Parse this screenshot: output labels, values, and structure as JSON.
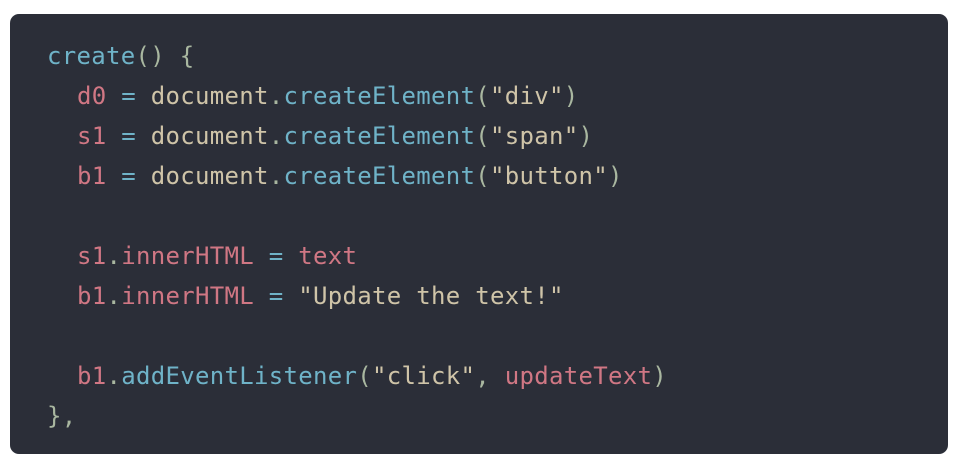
{
  "colors": {
    "background": "#2b2e38",
    "function": "#6fb3c8",
    "variable": "#d07784",
    "plain": "#cfc4a8",
    "punctuation": "#a9b7a0",
    "string": "#cfc4a8"
  },
  "code": {
    "lines": [
      [
        {
          "text": "create",
          "kind": "function"
        },
        {
          "text": "() {",
          "kind": "punctuation"
        }
      ],
      [
        {
          "text": "d0",
          "kind": "variable"
        },
        {
          "text": " = ",
          "kind": "function"
        },
        {
          "text": "document",
          "kind": "plain"
        },
        {
          "text": ".",
          "kind": "punctuation"
        },
        {
          "text": "createElement",
          "kind": "function"
        },
        {
          "text": "(",
          "kind": "punctuation"
        },
        {
          "text": "\"div\"",
          "kind": "string"
        },
        {
          "text": ")",
          "kind": "punctuation"
        }
      ],
      [
        {
          "text": "s1",
          "kind": "variable"
        },
        {
          "text": " = ",
          "kind": "function"
        },
        {
          "text": "document",
          "kind": "plain"
        },
        {
          "text": ".",
          "kind": "punctuation"
        },
        {
          "text": "createElement",
          "kind": "function"
        },
        {
          "text": "(",
          "kind": "punctuation"
        },
        {
          "text": "\"span\"",
          "kind": "string"
        },
        {
          "text": ")",
          "kind": "punctuation"
        }
      ],
      [
        {
          "text": "b1",
          "kind": "variable"
        },
        {
          "text": " = ",
          "kind": "function"
        },
        {
          "text": "document",
          "kind": "plain"
        },
        {
          "text": ".",
          "kind": "punctuation"
        },
        {
          "text": "createElement",
          "kind": "function"
        },
        {
          "text": "(",
          "kind": "punctuation"
        },
        {
          "text": "\"button\"",
          "kind": "string"
        },
        {
          "text": ")",
          "kind": "punctuation"
        }
      ],
      [],
      [
        {
          "text": "s1",
          "kind": "variable"
        },
        {
          "text": ".",
          "kind": "punctuation"
        },
        {
          "text": "innerHTML",
          "kind": "variable"
        },
        {
          "text": " = ",
          "kind": "function"
        },
        {
          "text": "text",
          "kind": "variable"
        }
      ],
      [
        {
          "text": "b1",
          "kind": "variable"
        },
        {
          "text": ".",
          "kind": "punctuation"
        },
        {
          "text": "innerHTML",
          "kind": "variable"
        },
        {
          "text": " = ",
          "kind": "function"
        },
        {
          "text": "\"Update the text!\"",
          "kind": "string"
        }
      ],
      [],
      [
        {
          "text": "b1",
          "kind": "variable"
        },
        {
          "text": ".",
          "kind": "punctuation"
        },
        {
          "text": "addEventListener",
          "kind": "function"
        },
        {
          "text": "(",
          "kind": "punctuation"
        },
        {
          "text": "\"click\"",
          "kind": "string"
        },
        {
          "text": ", ",
          "kind": "punctuation"
        },
        {
          "text": "updateText",
          "kind": "variable"
        },
        {
          "text": ")",
          "kind": "punctuation"
        }
      ],
      [
        {
          "text": "},",
          "kind": "punctuation"
        }
      ]
    ],
    "indented": [
      false,
      true,
      true,
      true,
      false,
      true,
      true,
      false,
      true,
      false
    ]
  }
}
